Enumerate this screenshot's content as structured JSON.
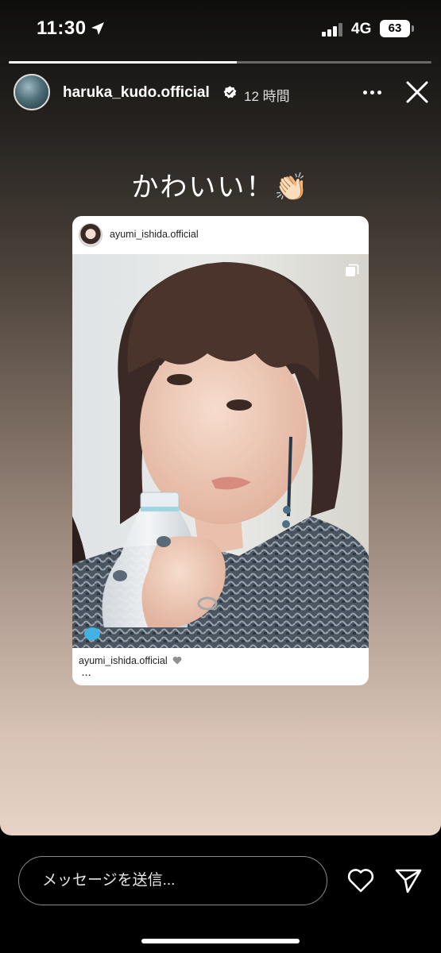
{
  "status_bar": {
    "time": "11:30",
    "network": "4G",
    "battery": "63"
  },
  "story": {
    "progress": 0.54,
    "username": "haruka_kudo.official",
    "time_ago": "12 時間",
    "text": "かわいい！👏🏻"
  },
  "post": {
    "username": "ayumi_ishida.official",
    "caption": "ayumi_ishida.official",
    "more": "..."
  },
  "reply": {
    "placeholder": "メッセージを送信..."
  }
}
